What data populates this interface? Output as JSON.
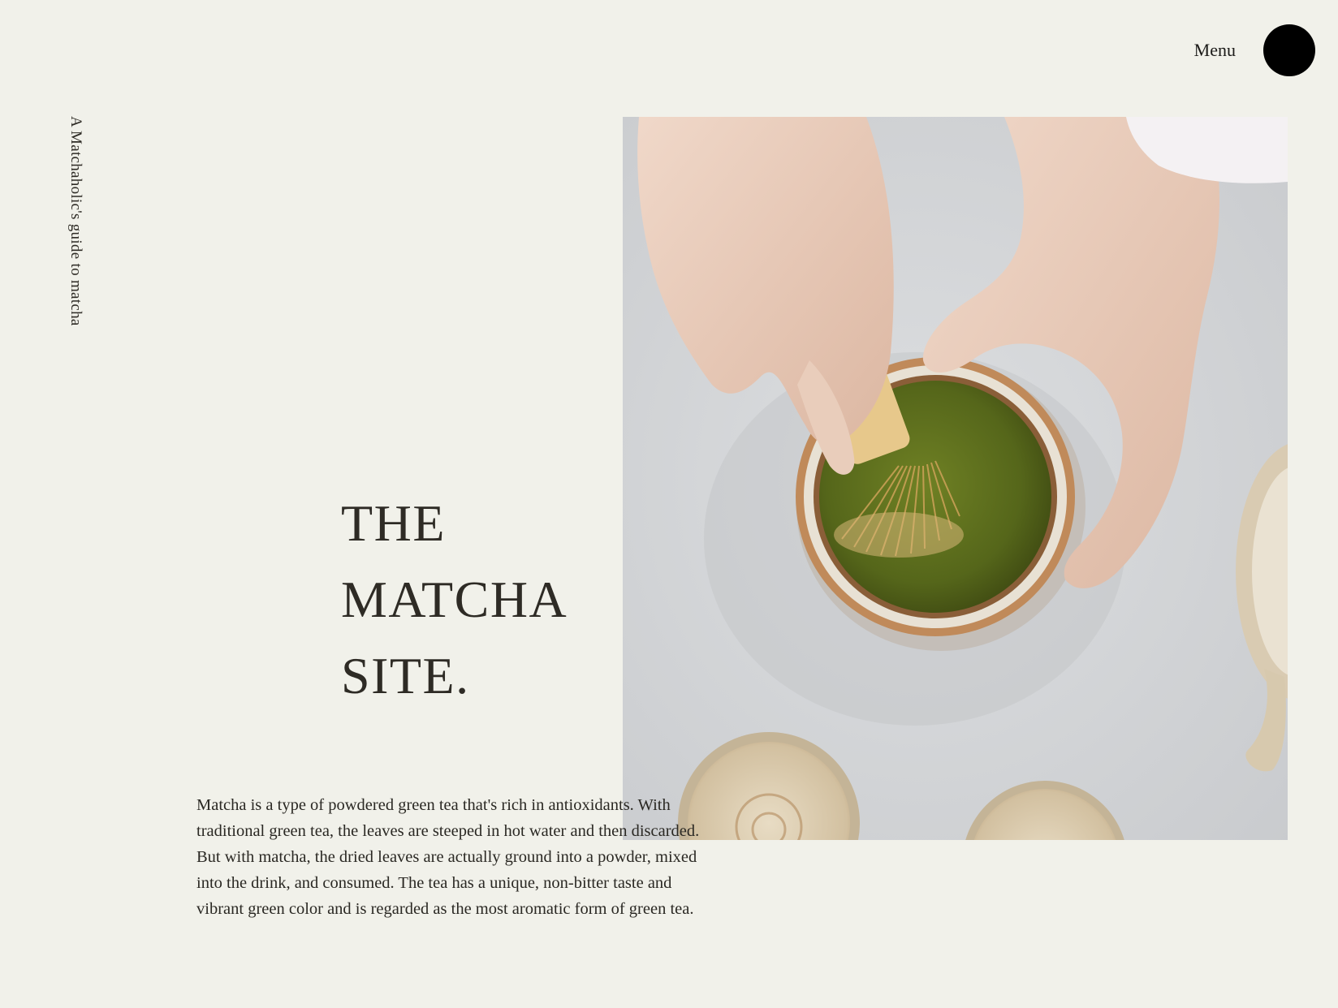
{
  "brand": {
    "tagline": "A Matchaholic's guide to matcha"
  },
  "nav": {
    "menu_label": "Menu"
  },
  "hero": {
    "title_lines": [
      "THE",
      "MATCHA",
      "SITE."
    ],
    "image_subject": "hands-whisking-matcha-photo"
  },
  "intro": {
    "text": "Matcha is a type of powdered green tea that's rich in antioxidants. With traditional green tea, the leaves are steeped in hot water and then discarded. But with matcha, the dried leaves are actually ground into a powder, mixed into the drink, and consumed. The tea has a unique, non-bitter taste and vibrant green color and is regarded as the most aromatic form of green tea."
  },
  "colors": {
    "background": "#f1f1ea",
    "text": "#2e2b25",
    "menu_dot": "#000000",
    "matcha_green": "#5a6b1c"
  }
}
